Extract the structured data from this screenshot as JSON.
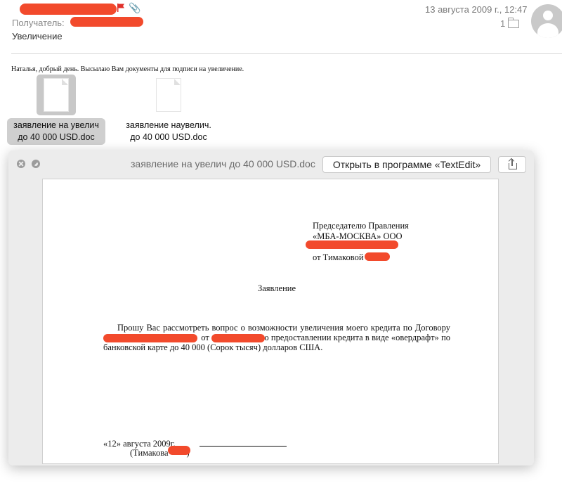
{
  "header": {
    "date": "13 августа 2009 г., 12:47",
    "recipient_label": "Получатель:",
    "subject": "Увеличение",
    "message_count": "1"
  },
  "body": {
    "greeting": "Наталья, добрый день. Высылаю Вам документы для подписи на увеличение."
  },
  "attachments": [
    {
      "line1": "заявление на увелич",
      "line2": "до 40 000 USD.doc"
    },
    {
      "line1": "заявление наувелич.",
      "line2": "до 40 000 USD.doc"
    }
  ],
  "quicklook": {
    "title": "заявление на увелич до 40 000 USD.doc",
    "open_button": "Открыть в программе «TextEdit»",
    "document": {
      "addr_line1": "Председателю Правления",
      "addr_line2": "«МБА-МОСКВА» ООО",
      "addr_line3": "от Тимаковой",
      "heading": "Заявление",
      "para_part1": "Прошу Вас рассмотреть вопрос о возможности увеличения моего кредита по Договору",
      "para_part2": "от",
      "para_part3": "о предоставлении кредита в виде «овердрафт» по банковской карте до 40 000 (Сорок тысяч) долларов США.",
      "date_line": "«12» августа 2009г.",
      "signature_name_prefix": "(Тимакова",
      "signature_name_suffix": ")"
    }
  },
  "colors": {
    "redaction": "#f24a2c",
    "flag": "#e0312b"
  },
  "icons": [
    "flag-icon",
    "paperclip-icon",
    "folder-icon",
    "avatar-icon",
    "document-icon",
    "close-icon",
    "fullscreen-icon",
    "share-icon"
  ]
}
